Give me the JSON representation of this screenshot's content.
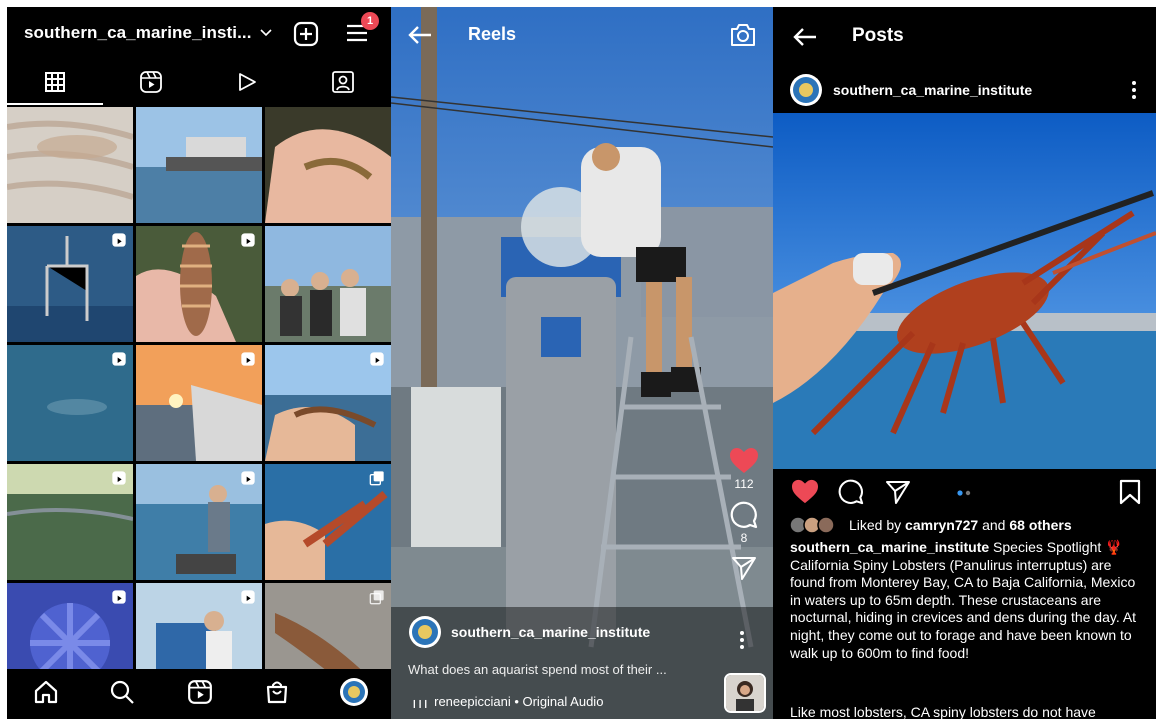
{
  "profile": {
    "account_name": "southern_ca_marine_insti...",
    "notification_count": "1",
    "tabs": [
      "grid-icon",
      "reels-icon",
      "video-icon",
      "tagged-icon"
    ]
  },
  "reels": {
    "title": "Reels",
    "like_count": "112",
    "comment_count": "8",
    "username": "southern_ca_marine_institute",
    "caption": "What does an aquarist spend most of their ...",
    "audio": "reneepicciani • Original Audio",
    "audio_prefix": "❙❙❙"
  },
  "post": {
    "title": "Posts",
    "username": "southern_ca_marine_institute",
    "liked_by_prefix": "Liked by ",
    "liked_by_user": "camryn727",
    "liked_by_and": " and ",
    "liked_by_others": "68 others",
    "caption_user": "southern_ca_marine_institute",
    "caption_text": " Species Spotlight 🦞 California Spiny Lobsters (Panulirus interruptus) are found from Monterey Bay, CA to Baja California, Mexico in waters up to 65m depth. These crustaceans are nocturnal, hiding in crevices and dens during the day. At night, they come out to forage and have been known to walk up to 600m to find food!",
    "caption_text2": "Like most lobsters, CA spiny lobsters do not have"
  },
  "colors": {
    "like_red": "#ed4956",
    "background": "#000000",
    "carousel_dot": "#3897f0"
  }
}
